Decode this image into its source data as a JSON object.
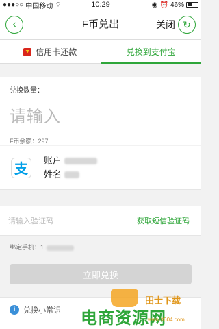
{
  "status_bar": {
    "carrier": "中国移动",
    "time": "10:29",
    "battery": "46%"
  },
  "navbar": {
    "title": "F币兑出",
    "close": "关闭"
  },
  "tabs": [
    {
      "label": "信用卡还款",
      "active": false
    },
    {
      "label": "兑换到支付宝",
      "active": true
    }
  ],
  "amount": {
    "label": "兑换数量：",
    "placeholder": "请输入",
    "balance": "F币余额：297"
  },
  "account": {
    "logo_char": "支",
    "account_label": "账户",
    "name_label": "姓名"
  },
  "verify": {
    "placeholder": "请输入验证码",
    "button": "获取短信验证码"
  },
  "bind_phone": {
    "label": "绑定手机：",
    "value": "1"
  },
  "submit": "立即兑换",
  "tips": "兑换小常识",
  "watermark": {
    "main": "电商资源网",
    "sub": "田士下载",
    "url": "www.it604.com"
  },
  "colors": {
    "accent": "#2fa63a",
    "disabled_button": "#d4d4d4"
  }
}
